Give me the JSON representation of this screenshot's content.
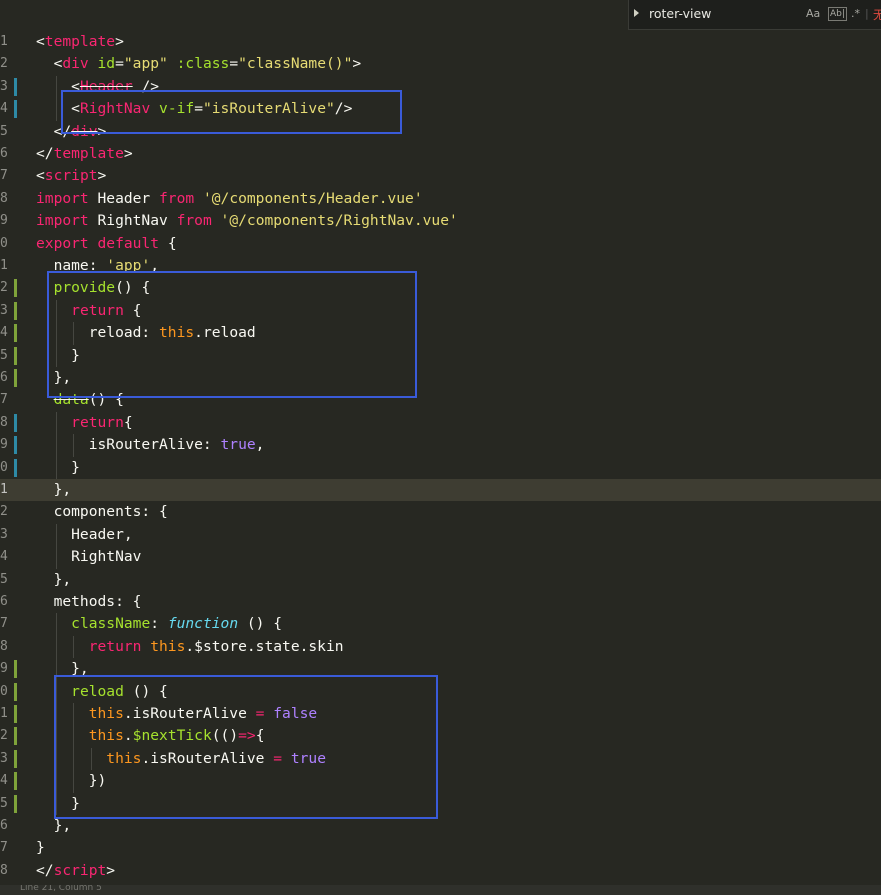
{
  "find_bar": {
    "query": "roter-view",
    "case_label": "Aa",
    "word_label": "Ab|",
    "regex_label": ".*",
    "clipped_text": "无"
  },
  "highlight_color": "#3A5BD9",
  "lines": [
    {
      "n": "1",
      "tokens": [
        [
          "p",
          "<"
        ],
        [
          "tag",
          "template"
        ],
        [
          "p",
          ">"
        ]
      ]
    },
    {
      "n": "2",
      "tokens": [
        [
          "p",
          "  <"
        ],
        [
          "tag",
          "div"
        ],
        [
          "p",
          " "
        ],
        [
          "attr",
          "id"
        ],
        [
          "p",
          "="
        ],
        [
          "str",
          "\"app\""
        ],
        [
          "p",
          " "
        ],
        [
          "attr",
          ":class"
        ],
        [
          "p",
          "="
        ],
        [
          "str",
          "\"className()\""
        ],
        [
          "p",
          ">"
        ]
      ]
    },
    {
      "n": "3",
      "tokens": [
        [
          "p",
          "    <"
        ],
        [
          "tagx",
          "Header"
        ],
        [
          "p",
          " />"
        ]
      ]
    },
    {
      "n": "4",
      "tokens": [
        [
          "p",
          "    <"
        ],
        [
          "tag",
          "RightNav"
        ],
        [
          "p",
          " "
        ],
        [
          "attr",
          "v-if"
        ],
        [
          "p",
          "="
        ],
        [
          "str",
          "\"isRouterAlive\""
        ],
        [
          "p",
          "/>"
        ]
      ]
    },
    {
      "n": "5",
      "tokens": [
        [
          "p",
          "  </"
        ],
        [
          "tagx",
          "div"
        ],
        [
          "p",
          ">"
        ]
      ]
    },
    {
      "n": "6",
      "tokens": [
        [
          "p",
          "</"
        ],
        [
          "tag",
          "template"
        ],
        [
          "p",
          ">"
        ]
      ]
    },
    {
      "n": "7",
      "tokens": [
        [
          "p",
          "<"
        ],
        [
          "tag",
          "script"
        ],
        [
          "p",
          ">"
        ]
      ]
    },
    {
      "n": "8",
      "tokens": [
        [
          "kw",
          "import"
        ],
        [
          "p",
          " Header "
        ],
        [
          "kw",
          "from"
        ],
        [
          "p",
          " "
        ],
        [
          "str",
          "'@/components/Header.vue'"
        ]
      ]
    },
    {
      "n": "9",
      "tokens": [
        [
          "kw",
          "import"
        ],
        [
          "p",
          " RightNav "
        ],
        [
          "kw",
          "from"
        ],
        [
          "p",
          " "
        ],
        [
          "str",
          "'@/components/RightNav.vue'"
        ]
      ]
    },
    {
      "n": "0",
      "tokens": [
        [
          "kw",
          "export"
        ],
        [
          "p",
          " "
        ],
        [
          "kw",
          "default"
        ],
        [
          "p",
          " {"
        ]
      ]
    },
    {
      "n": "1",
      "tokens": [
        [
          "p",
          "  name: "
        ],
        [
          "str",
          "'app'"
        ],
        [
          "p",
          ","
        ]
      ]
    },
    {
      "n": "2",
      "tokens": [
        [
          "p",
          "  "
        ],
        [
          "fn",
          "provide"
        ],
        [
          "p",
          "() {"
        ]
      ]
    },
    {
      "n": "3",
      "tokens": [
        [
          "p",
          "    "
        ],
        [
          "kw",
          "return"
        ],
        [
          "p",
          " {"
        ]
      ]
    },
    {
      "n": "4",
      "tokens": [
        [
          "p",
          "      reload: "
        ],
        [
          "this",
          "this"
        ],
        [
          "p",
          ".reload"
        ]
      ]
    },
    {
      "n": "5",
      "tokens": [
        [
          "p",
          "    }"
        ]
      ]
    },
    {
      "n": "6",
      "tokens": [
        [
          "p",
          "  },"
        ]
      ]
    },
    {
      "n": "7",
      "tokens": [
        [
          "p",
          "  "
        ],
        [
          "fnx",
          "data"
        ],
        [
          "p",
          "() {"
        ]
      ]
    },
    {
      "n": "8",
      "tokens": [
        [
          "p",
          "    "
        ],
        [
          "kw",
          "return"
        ],
        [
          "p",
          "{"
        ]
      ]
    },
    {
      "n": "9",
      "tokens": [
        [
          "p",
          "      isRouterAlive: "
        ],
        [
          "bool",
          "true"
        ],
        [
          "p",
          ","
        ]
      ]
    },
    {
      "n": "0",
      "tokens": [
        [
          "p",
          "    }"
        ]
      ]
    },
    {
      "n": "1",
      "tokens": [
        [
          "p",
          "  },"
        ]
      ],
      "active": true
    },
    {
      "n": "2",
      "tokens": [
        [
          "p",
          "  components: {"
        ]
      ]
    },
    {
      "n": "3",
      "tokens": [
        [
          "p",
          "    Header,"
        ]
      ]
    },
    {
      "n": "4",
      "tokens": [
        [
          "p",
          "    RightNav"
        ]
      ]
    },
    {
      "n": "5",
      "tokens": [
        [
          "p",
          "  },"
        ]
      ]
    },
    {
      "n": "6",
      "tokens": [
        [
          "p",
          "  methods: {"
        ]
      ]
    },
    {
      "n": "7",
      "tokens": [
        [
          "p",
          "    "
        ],
        [
          "fn",
          "className"
        ],
        [
          "p",
          ": "
        ],
        [
          "type",
          "function"
        ],
        [
          "p",
          " () {"
        ]
      ]
    },
    {
      "n": "8",
      "tokens": [
        [
          "p",
          "      "
        ],
        [
          "kw",
          "return"
        ],
        [
          "p",
          " "
        ],
        [
          "this",
          "this"
        ],
        [
          "p",
          ".$store.state.skin"
        ]
      ]
    },
    {
      "n": "9",
      "tokens": [
        [
          "p",
          "    },"
        ]
      ]
    },
    {
      "n": "0",
      "tokens": [
        [
          "p",
          "    "
        ],
        [
          "fn",
          "reload"
        ],
        [
          "p",
          " () {"
        ]
      ]
    },
    {
      "n": "1",
      "tokens": [
        [
          "p",
          "      "
        ],
        [
          "this",
          "this"
        ],
        [
          "p",
          ".isRouterAlive "
        ],
        [
          "kw",
          "="
        ],
        [
          "p",
          " "
        ],
        [
          "bool",
          "false"
        ]
      ]
    },
    {
      "n": "2",
      "tokens": [
        [
          "p",
          "      "
        ],
        [
          "this",
          "this"
        ],
        [
          "p",
          "."
        ],
        [
          "fn",
          "$nextTick"
        ],
        [
          "p",
          "(()"
        ],
        [
          "kw",
          "=>"
        ],
        [
          "p",
          "{"
        ]
      ]
    },
    {
      "n": "3",
      "tokens": [
        [
          "p",
          "        "
        ],
        [
          "this",
          "this"
        ],
        [
          "p",
          ".isRouterAlive "
        ],
        [
          "kw",
          "="
        ],
        [
          "p",
          " "
        ],
        [
          "bool",
          "true"
        ]
      ]
    },
    {
      "n": "4",
      "tokens": [
        [
          "p",
          "      })"
        ]
      ]
    },
    {
      "n": "5",
      "tokens": [
        [
          "p",
          "    }"
        ]
      ]
    },
    {
      "n": "6",
      "tokens": [
        [
          "p",
          "  },"
        ]
      ]
    },
    {
      "n": "7",
      "tokens": [
        [
          "p",
          "}"
        ]
      ]
    },
    {
      "n": "8",
      "tokens": [
        [
          "p",
          "</"
        ],
        [
          "tag",
          "script"
        ],
        [
          "p",
          ">"
        ]
      ]
    }
  ],
  "status_text": "Line 21, Column 5"
}
